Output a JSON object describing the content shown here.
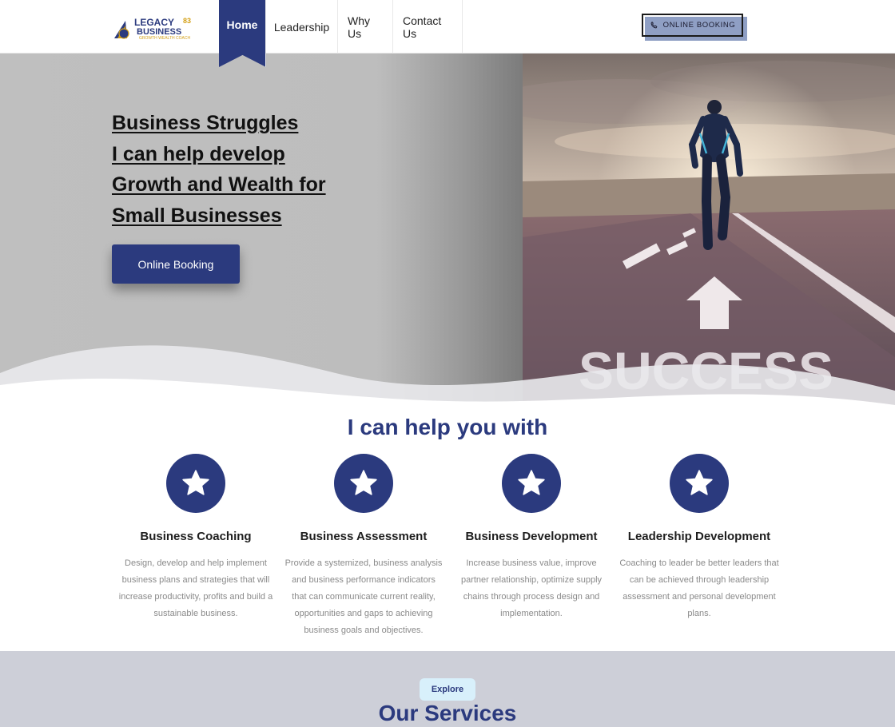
{
  "header": {
    "logo": {
      "line1": "LEGACY83",
      "line2": "BUSINESS",
      "tagline": "GROWTH WEALTH COACH"
    },
    "nav": [
      {
        "label": "Home",
        "active": true
      },
      {
        "label": "Leadership"
      },
      {
        "label": "Why Us"
      },
      {
        "label": "Contact Us"
      }
    ],
    "booking_label": "ONLINE BOOKING",
    "booking_icon": "phone-icon"
  },
  "hero": {
    "title_lines": [
      "Business Struggles",
      "I can help develop",
      "Growth and Wealth for",
      "Small Businesses"
    ],
    "button_label": "Online Booking",
    "image_text": "SUCCESS"
  },
  "help": {
    "title": "I can help you with",
    "cards": [
      {
        "icon": "star-icon",
        "title": "Business Coaching",
        "text": "Design, develop and help implement business plans and strategies that will increase productivity, profits and build a sustainable business."
      },
      {
        "icon": "star-icon",
        "title": "Business Assessment",
        "text": "Provide a systemized, business analysis and business performance indicators that can communicate current reality, opportunities and gaps to achieving business goals and objectives."
      },
      {
        "icon": "star-icon",
        "title": "Business Development",
        "text": "Increase business value, improve partner relationship, optimize supply chains through process design and implementation."
      },
      {
        "icon": "star-icon",
        "title": "Leadership Development",
        "text": "Coaching to leader be better leaders that can be achieved through leadership assessment and personal development plans."
      }
    ]
  },
  "services": {
    "badge": "Explore",
    "title": "Our Services"
  },
  "colors": {
    "brand": "#2b3a7e",
    "hero_bg": "#bdbdbd",
    "services_bg": "#cdcfd8",
    "badge_bg": "#d8f0fb"
  }
}
